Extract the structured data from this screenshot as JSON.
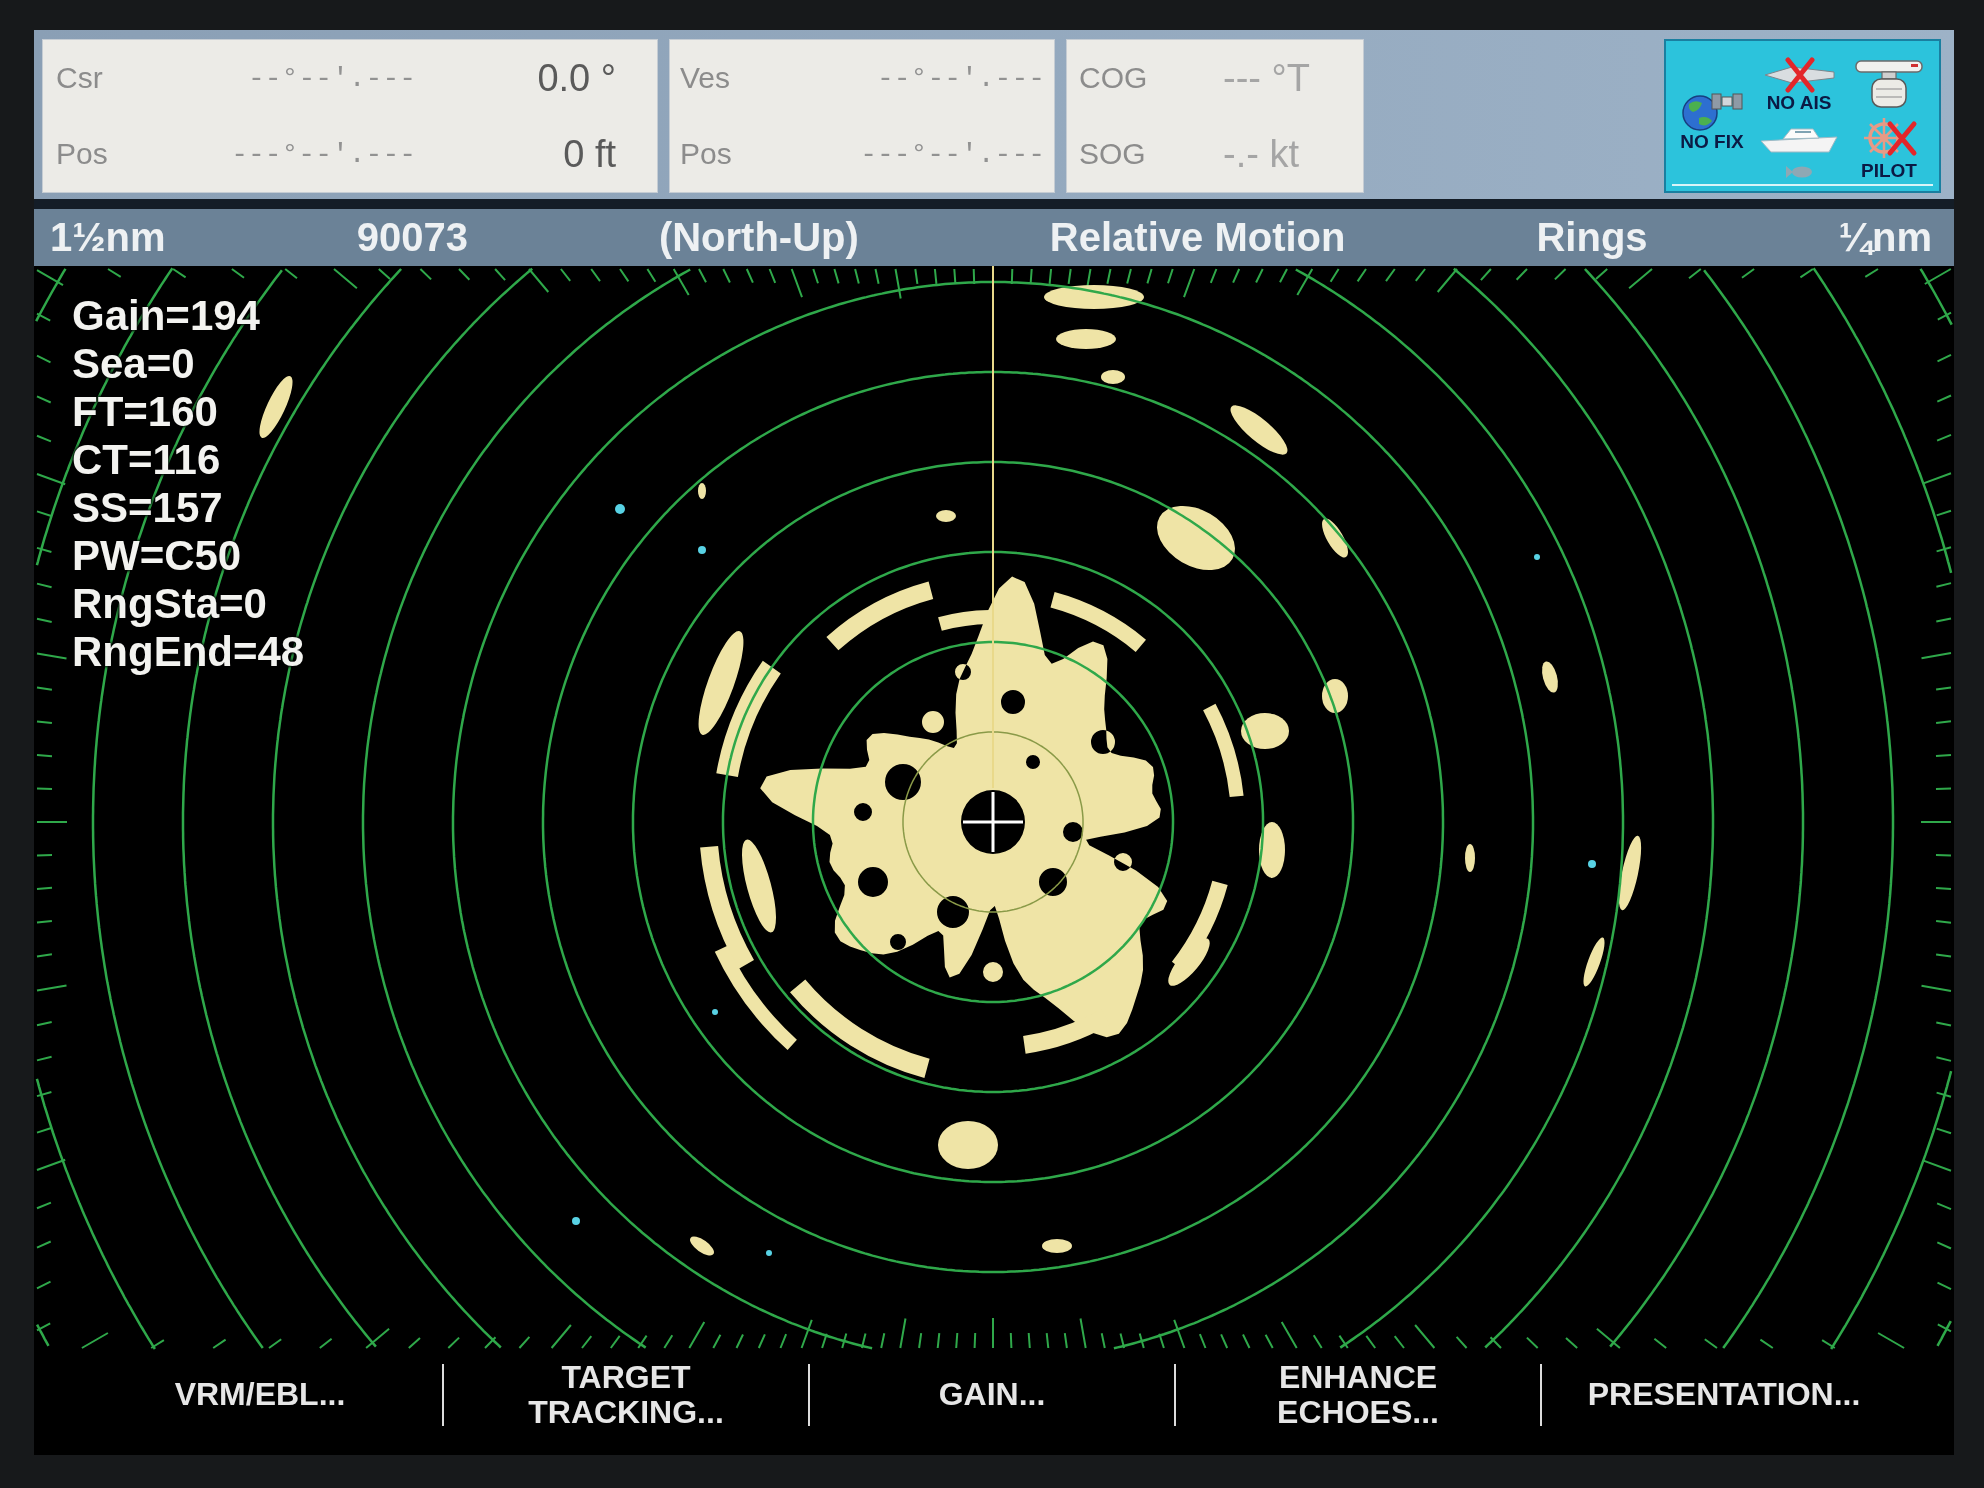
{
  "data_bar": {
    "panels": [
      {
        "rows": [
          {
            "label": "Csr",
            "position": "--°--'.---",
            "value": "0.0 °",
            "greyed": false
          },
          {
            "label": "Pos",
            "position": "---°--'.---",
            "value": "0 ft",
            "greyed": false
          }
        ]
      },
      {
        "rows": [
          {
            "label": "Ves",
            "position": "--°--'.---"
          },
          {
            "label": "Pos",
            "position": "---°--'.---"
          }
        ]
      },
      {
        "rows": [
          {
            "label": "COG",
            "value": "--- °T",
            "greyed": true
          },
          {
            "label": "SOG",
            "value": "-.- kt",
            "greyed": true
          }
        ]
      }
    ],
    "status_icons": [
      {
        "kind": "gps",
        "label": "NO FIX",
        "crossed": false
      },
      {
        "kind": "ais",
        "label": "NO AIS",
        "crossed": true
      },
      {
        "kind": "boat",
        "crossed": false
      },
      {
        "kind": "fish",
        "crossed": false
      },
      {
        "kind": "radar",
        "crossed": false
      },
      {
        "kind": "autopilot",
        "label": "PILOT",
        "crossed": true
      }
    ]
  },
  "header_bar": {
    "range": "1½nm",
    "field_2": "90073",
    "orientation": "(North-Up)",
    "motion_mode": "Relative Motion",
    "rings_label": "Rings",
    "ring_interval": "¼nm"
  },
  "radar": {
    "readouts": [
      "Gain=194",
      "Sea=0",
      "FT=160",
      "CT=116",
      "SS=157",
      "PW=C50",
      "RngSta=0",
      "RngEnd=48"
    ]
  },
  "softkeys": [
    "VRM/EBL...",
    "TARGET\nTRACKING...",
    "GAIN...",
    "ENHANCE\nECHOES...",
    "PRESENTATION..."
  ]
}
